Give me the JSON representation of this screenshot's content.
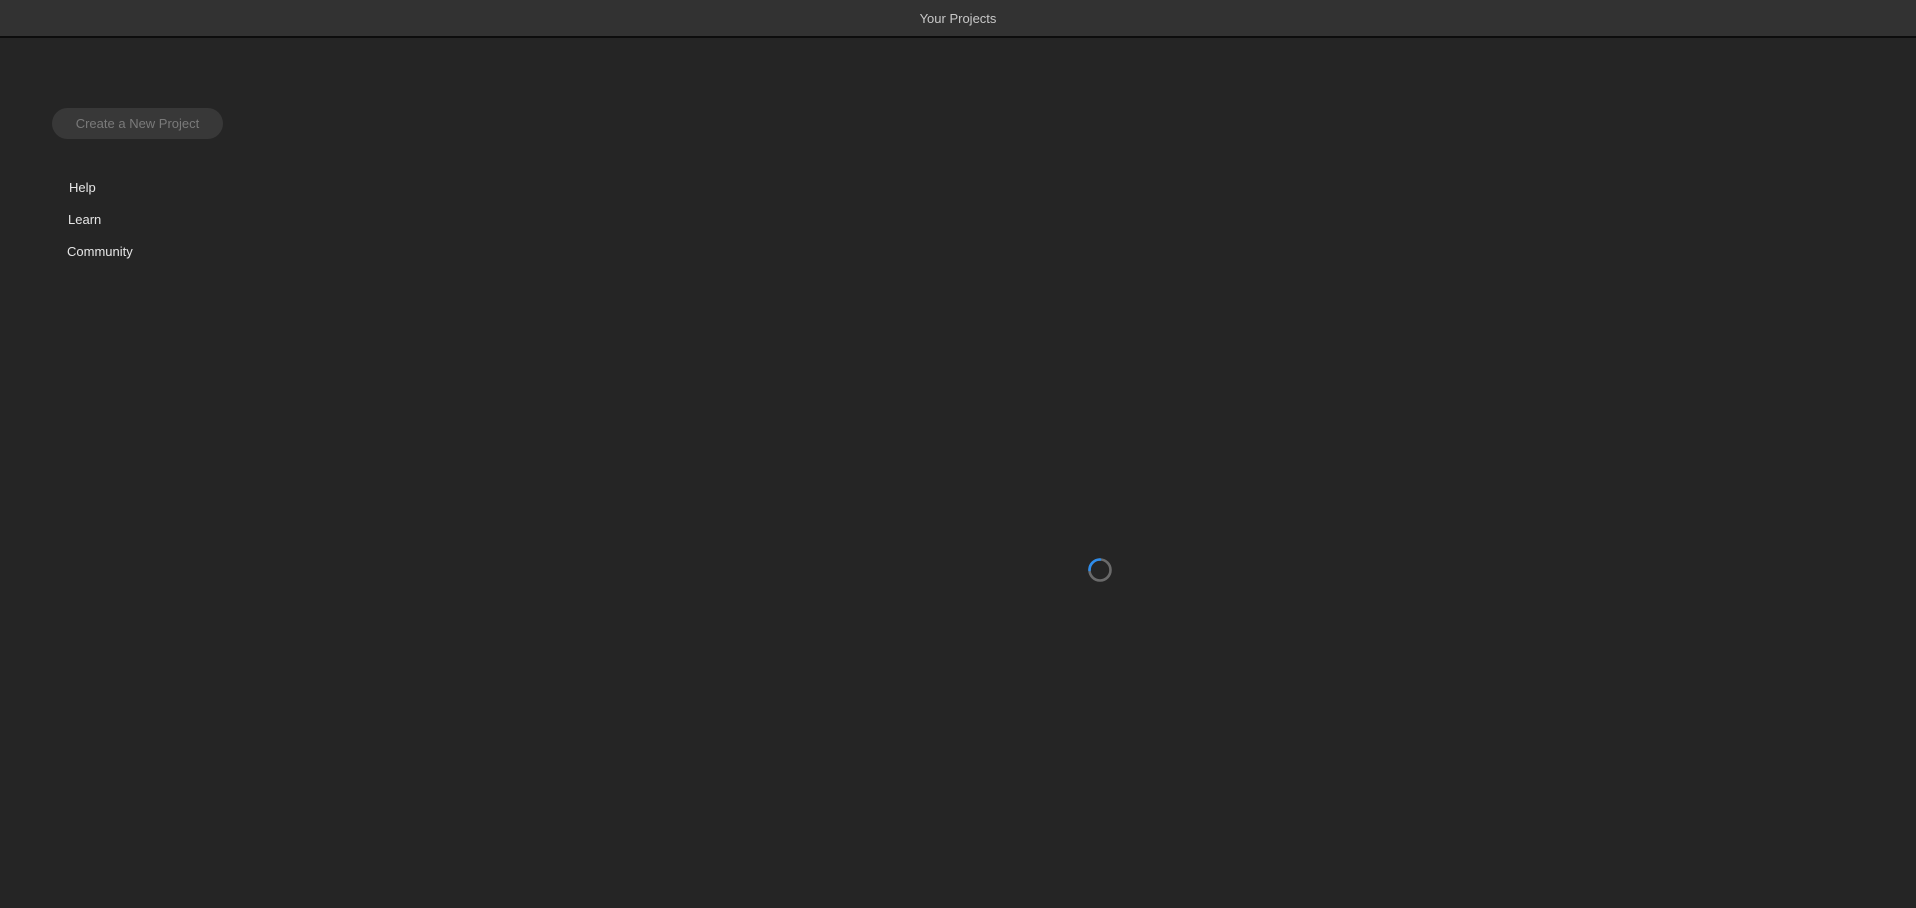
{
  "window": {
    "title": "Your Projects"
  },
  "sidebar": {
    "create_button_label": "Create a New Project",
    "links": [
      {
        "label": "Help"
      },
      {
        "label": "Learn"
      },
      {
        "label": "Community"
      }
    ]
  },
  "main": {
    "loading_icon": "spinner-icon"
  },
  "colors": {
    "background": "#252525",
    "titlebar": "#323232",
    "spinner_accent": "#2d8ceb"
  }
}
